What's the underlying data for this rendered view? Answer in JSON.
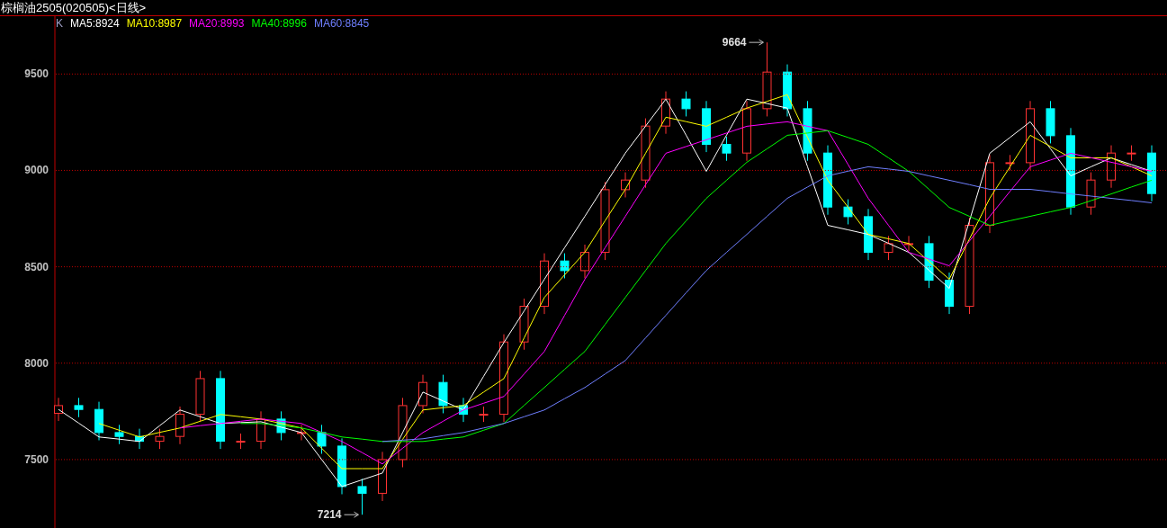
{
  "title": "棕榈油2505(020505)<日线>",
  "legend_key": {
    "label": "K",
    "color": "#a0a0c8"
  },
  "candles": {
    "chart_data": {
      "type": "candlestick",
      "ylim": [
        7145,
        9800
      ],
      "ohlc": [
        [
          7740,
          7820,
          7700,
          7780
        ],
        [
          7780,
          7820,
          7720,
          7760
        ],
        [
          7760,
          7800,
          7600,
          7640
        ],
        [
          7640,
          7680,
          7580,
          7620
        ],
        [
          7620,
          7660,
          7555,
          7595
        ],
        [
          7595,
          7660,
          7555,
          7620
        ],
        [
          7620,
          7775,
          7580,
          7735
        ],
        [
          7735,
          7960,
          7695,
          7920
        ],
        [
          7920,
          7960,
          7555,
          7595
        ],
        [
          7595,
          7635,
          7555,
          7595
        ],
        [
          7595,
          7750,
          7555,
          7710
        ],
        [
          7710,
          7750,
          7600,
          7640
        ],
        [
          7640,
          7680,
          7600,
          7640
        ],
        [
          7640,
          7680,
          7530,
          7570
        ],
        [
          7570,
          7610,
          7320,
          7360
        ],
        [
          7360,
          7400,
          7214,
          7325
        ],
        [
          7325,
          7540,
          7285,
          7500
        ],
        [
          7500,
          7820,
          7460,
          7780
        ],
        [
          7780,
          7940,
          7740,
          7900
        ],
        [
          7900,
          7940,
          7740,
          7780
        ],
        [
          7780,
          7820,
          7695,
          7735
        ],
        [
          7735,
          7775,
          7695,
          7735
        ],
        [
          7735,
          8150,
          7695,
          8110
        ],
        [
          8110,
          8335,
          8070,
          8295
        ],
        [
          8295,
          8570,
          8255,
          8530
        ],
        [
          8530,
          8570,
          8440,
          8480
        ],
        [
          8480,
          8615,
          8440,
          8575
        ],
        [
          8575,
          8940,
          8535,
          8900
        ],
        [
          8900,
          8990,
          8860,
          8950
        ],
        [
          8950,
          9270,
          8910,
          9230
        ],
        [
          9230,
          9410,
          9190,
          9370
        ],
        [
          9370,
          9410,
          9280,
          9320
        ],
        [
          9320,
          9360,
          9095,
          9135
        ],
        [
          9135,
          9175,
          9050,
          9090
        ],
        [
          9090,
          9360,
          9050,
          9320
        ],
        [
          9320,
          9664,
          9280,
          9510
        ],
        [
          9510,
          9550,
          9280,
          9320
        ],
        [
          9320,
          9360,
          9050,
          9090
        ],
        [
          9090,
          9130,
          8770,
          8810
        ],
        [
          8810,
          8850,
          8720,
          8760
        ],
        [
          8760,
          8800,
          8535,
          8575
        ],
        [
          8575,
          8660,
          8535,
          8620
        ],
        [
          8620,
          8660,
          8580,
          8620
        ],
        [
          8620,
          8660,
          8390,
          8430
        ],
        [
          8430,
          8470,
          8255,
          8295
        ],
        [
          8295,
          8755,
          8255,
          8715
        ],
        [
          8715,
          9080,
          8675,
          9040
        ],
        [
          9040,
          9080,
          9000,
          9040
        ],
        [
          9040,
          9360,
          9000,
          9320
        ],
        [
          9320,
          9360,
          9140,
          9180
        ],
        [
          9180,
          9220,
          8770,
          8810
        ],
        [
          8810,
          8990,
          8770,
          8950
        ],
        [
          8950,
          9130,
          8910,
          9090
        ],
        [
          9090,
          9130,
          9050,
          9090
        ],
        [
          9090,
          9130,
          8840,
          8880
        ]
      ],
      "annotations": [
        "9664",
        "7214"
      ]
    }
  },
  "moving_averages": {
    "chart_data": {
      "type": "line",
      "ylim": [
        7145,
        9800
      ],
      "yticks": [
        7500,
        8000,
        8500,
        9000,
        9500
      ],
      "grid": true,
      "series": [
        {
          "name": "MA5:8924",
          "color": "#ffffff",
          "values": [
            7760,
            7689,
            7617,
            7606,
            7594,
            7676,
            7757,
            7722,
            7687,
            7692,
            7696,
            7668,
            7640,
            7500,
            7360,
            7395,
            7430,
            7640,
            7850,
            7804,
            7757,
            7932,
            8107,
            8271,
            8435,
            8599,
            8762,
            8926,
            9090,
            9230,
            9370,
            9183,
            8995,
            9183,
            9370,
            9347,
            9323,
            9019,
            8715,
            8692,
            8668,
            8622,
            8575,
            8482,
            8388,
            8739,
            9089,
            9171,
            9252,
            9112,
            8972,
            9019,
            9065,
            9030,
            8995
          ]
        },
        {
          "name": "MA10:8987",
          "color": "#ffff00",
          "values": [
            null,
            null,
            7687,
            7652,
            7617,
            7641,
            7664,
            7699,
            7734,
            7722,
            7710,
            7687,
            7664,
            7559,
            7453,
            7453,
            7453,
            7605,
            7757,
            7769,
            7780,
            7850,
            7920,
            8131,
            8341,
            8458,
            8575,
            8739,
            8902,
            9089,
            9276,
            9253,
            9229,
            9276,
            9323,
            9358,
            9393,
            9171,
            8949,
            8809,
            8668,
            8645,
            8621,
            8528,
            8435,
            8645,
            8855,
            9019,
            9182,
            9124,
            9065,
            9065,
            9065,
            9019,
            8972
          ]
        },
        {
          "name": "MA20:8993",
          "color": "#ff00ff",
          "values": [
            null,
            null,
            null,
            null,
            null,
            null,
            7664,
            7676,
            7687,
            7699,
            7710,
            7699,
            7687,
            7641,
            7594,
            7536,
            7477,
            7559,
            7640,
            7699,
            7757,
            7792,
            7827,
            7944,
            8061,
            8248,
            8435,
            8599,
            8762,
            8926,
            9089,
            9124,
            9159,
            9194,
            9229,
            9241,
            9252,
            9229,
            9206,
            9031,
            8855,
            8715,
            8575,
            8540,
            8505,
            8634,
            8762,
            8891,
            9019,
            9054,
            9089,
            9066,
            9042,
            9019,
            8995
          ]
        },
        {
          "name": "MA40:8996",
          "color": "#00ff00",
          "values": [
            null,
            null,
            null,
            null,
            null,
            null,
            null,
            null,
            null,
            7687,
            7687,
            7676,
            7664,
            7641,
            7617,
            7606,
            7594,
            7594,
            7594,
            7606,
            7617,
            7652,
            7687,
            7781,
            7874,
            7968,
            8061,
            8201,
            8341,
            8481,
            8621,
            8738,
            8855,
            8949,
            9042,
            9112,
            9182,
            9194,
            9206,
            9171,
            9135,
            9065,
            8995,
            8902,
            8808,
            8762,
            8715,
            8739,
            8762,
            8785,
            8808,
            8843,
            8878,
            8914,
            8949
          ]
        },
        {
          "name": "MA60:8845",
          "color": "#6f7fff",
          "values": [
            null,
            null,
            null,
            null,
            null,
            null,
            null,
            null,
            null,
            null,
            null,
            null,
            null,
            null,
            null,
            null,
            7594,
            7601,
            7608,
            7624,
            7640,
            7664,
            7687,
            7722,
            7757,
            7816,
            7874,
            7944,
            8014,
            8131,
            8248,
            8365,
            8481,
            8575,
            8668,
            8762,
            8855,
            8914,
            8972,
            8996,
            9019,
            9007,
            8995,
            8972,
            8949,
            8926,
            8902,
            8902,
            8902,
            8890,
            8878,
            8867,
            8855,
            8844,
            8832
          ]
        }
      ]
    }
  }
}
